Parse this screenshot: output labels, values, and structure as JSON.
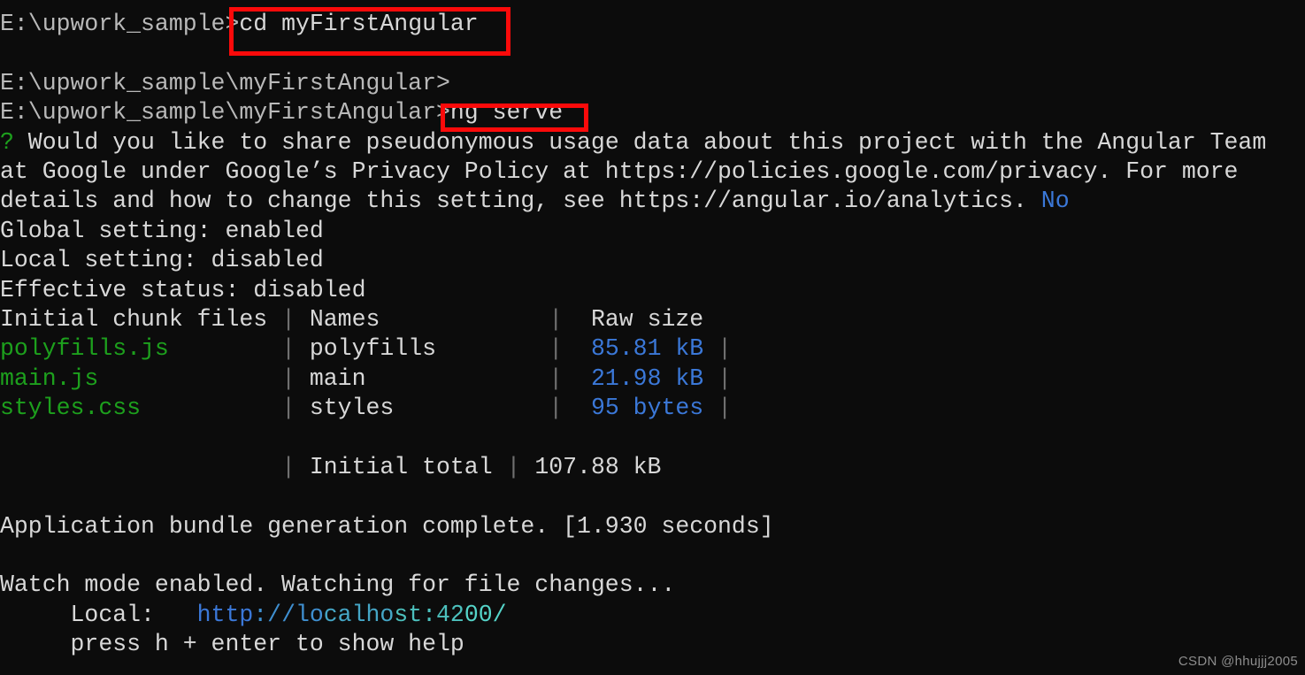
{
  "terminal": {
    "background_color": "#0c0c0c",
    "default_text_color": "#cccccc",
    "prompt_line_1": "E:\\upwork_sample>",
    "command_1": "cd myFirstAngular",
    "blank_1": "",
    "prompt_line_2": "E:\\upwork_sample\\myFirstAngular>",
    "prompt_line_3": "E:\\upwork_sample\\myFirstAngular>",
    "command_2": "ng serve",
    "analytics": {
      "question_mark": "?",
      "question_line_1": " Would you like to share pseudonymous usage data about this project with the Angular Team",
      "question_line_2": "at Google under Google’s Privacy Policy at https://policies.google.com/privacy. For more",
      "question_line_3": "details and how to change this setting, see https://angular.io/analytics. ",
      "answer": "No",
      "global_setting": "Global setting: enabled",
      "local_setting": "Local setting: disabled",
      "effective_status": "Effective status: disabled"
    },
    "build_table": {
      "header": {
        "col1": "Initial chunk files",
        "col2": "Names",
        "col3": "Raw size",
        "pipe": "|"
      },
      "rows": [
        {
          "file": "polyfills.js",
          "name": "polyfills",
          "size": "85.81 kB"
        },
        {
          "file": "main.js",
          "name": "main",
          "size": "21.98 kB"
        },
        {
          "file": "styles.css",
          "name": "styles",
          "size": "95 bytes"
        }
      ],
      "total": {
        "label": "Initial total",
        "size": "107.88 kB",
        "pipe": "|"
      }
    },
    "build_complete": "Application bundle generation complete. [1.930 seconds]",
    "watch_mode": "Watch mode enabled. Watching for file changes...",
    "local_label": "     Local:   ",
    "local_url_parts": {
      "p1": "http",
      "p2": "://lo",
      "p3": "calho",
      "p4": "st:42",
      "p5": "00/"
    },
    "help_hint": "     press h + enter to show help"
  },
  "annotations": {
    "box_color": "#fb0a0a",
    "box_1_target": "cd myFirstAngular",
    "box_2_target": "ng serve"
  },
  "watermark": {
    "text": "CSDN @hhujjj2005"
  }
}
